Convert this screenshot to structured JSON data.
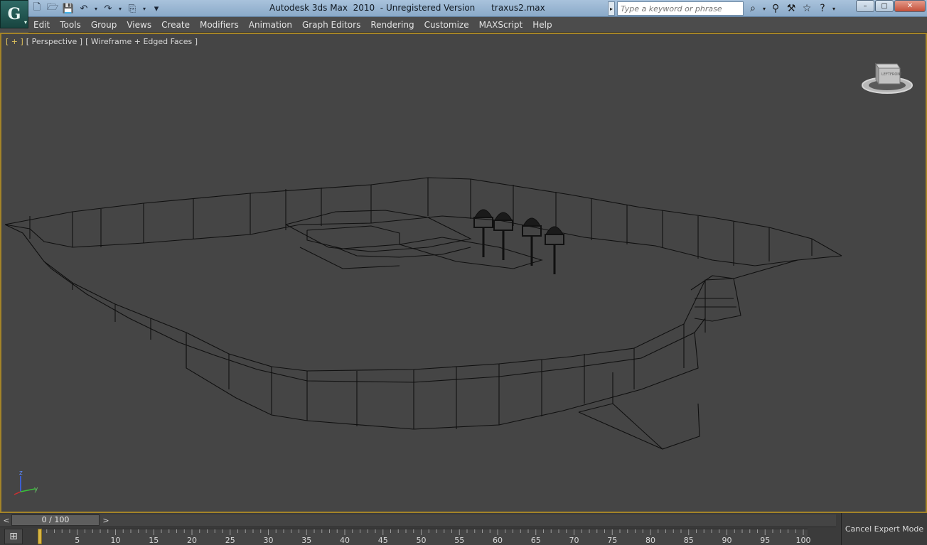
{
  "window": {
    "title": "Autodesk 3ds Max  2010  - Unregistered Version      traxus2.max",
    "app_logo": "G",
    "win_buttons": {
      "minimize": "–",
      "maximize": "▢",
      "close": "✕"
    }
  },
  "quick_access": [
    {
      "name": "new-file-icon",
      "glyph": "🗋"
    },
    {
      "name": "open-file-icon",
      "glyph": "🗁"
    },
    {
      "name": "save-icon",
      "glyph": "💾"
    },
    {
      "name": "undo-icon",
      "glyph": "↶"
    },
    {
      "name": "undo-dropdown-icon",
      "glyph": "▾",
      "small": true
    },
    {
      "name": "redo-icon",
      "glyph": "↷"
    },
    {
      "name": "redo-dropdown-icon",
      "glyph": "▾",
      "small": true
    },
    {
      "name": "project-folder-icon",
      "glyph": "⎘"
    },
    {
      "name": "project-dropdown-icon",
      "glyph": "▾",
      "small": true
    },
    {
      "name": "customize-qat-icon",
      "glyph": "▾"
    }
  ],
  "search": {
    "placeholder": "Type a keyword or phrase",
    "arrow": "▸"
  },
  "help_icons": [
    {
      "name": "binoculars-icon",
      "glyph": "⌕"
    },
    {
      "name": "binoculars-dropdown-icon",
      "glyph": "▾",
      "small": true
    },
    {
      "name": "communication-center-icon",
      "glyph": "⚲"
    },
    {
      "name": "subscription-icon",
      "glyph": "⚒"
    },
    {
      "name": "favorites-star-icon",
      "glyph": "☆"
    },
    {
      "name": "help-icon",
      "glyph": "?"
    },
    {
      "name": "help-dropdown-icon",
      "glyph": "▾",
      "small": true
    }
  ],
  "menu": [
    "Edit",
    "Tools",
    "Group",
    "Views",
    "Create",
    "Modifiers",
    "Animation",
    "Graph Editors",
    "Rendering",
    "Customize",
    "MAXScript",
    "Help"
  ],
  "viewport": {
    "label_plus": "[ + ]",
    "label_view": "[ Perspective ]",
    "label_shading": "[ Wireframe + Edged Faces ]",
    "bg_color": "#454545",
    "border_color": "#a48428",
    "axis": {
      "x": "x",
      "y": "y",
      "z": "z"
    },
    "viewcube": {
      "left": "LEFT",
      "front": "FRONT"
    }
  },
  "timeslider": {
    "frame_display": "0 / 100",
    "prev": "<",
    "next": ">",
    "ruler_labels": [
      "5",
      "10",
      "15",
      "20",
      "25",
      "30",
      "35",
      "40",
      "45",
      "50",
      "55",
      "60",
      "65",
      "70",
      "75",
      "80",
      "85",
      "90",
      "95",
      "100"
    ],
    "trackbar_icon": "⊞"
  },
  "status": {
    "expert_mode": "Cancel Expert Mode"
  }
}
